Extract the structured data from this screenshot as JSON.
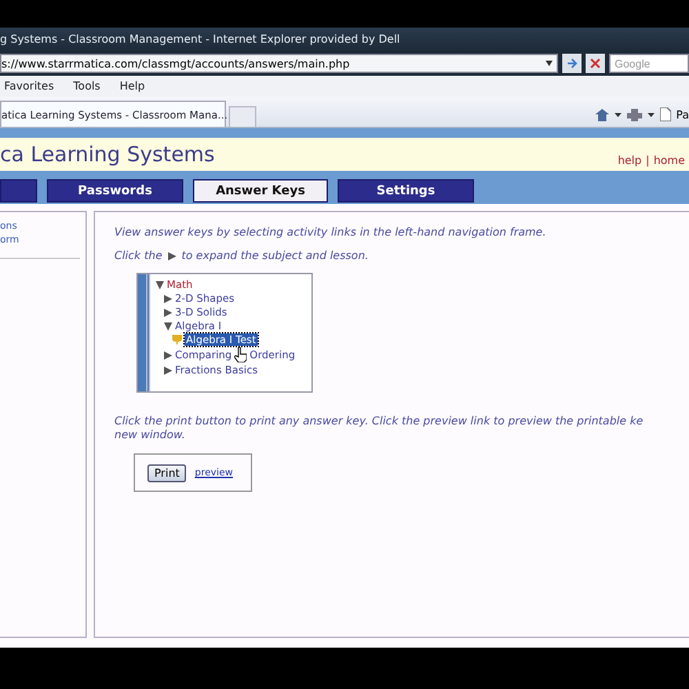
{
  "window": {
    "title": "g Systems - Classroom Management - Internet Explorer provided by Dell"
  },
  "address_bar": {
    "url": "s://www.starrmatica.com/classmgt/accounts/answers/main.php"
  },
  "search": {
    "placeholder": "Google"
  },
  "menu": [
    "Favorites",
    "Tools",
    "Help"
  ],
  "browser_tab": {
    "label": "atica Learning Systems - Classroom Mana..."
  },
  "toolbar": {
    "page_label": "Pa"
  },
  "site": {
    "title": "ca Learning Systems",
    "links": [
      "help",
      "home"
    ],
    "separator": "|"
  },
  "nav_tabs": [
    {
      "selected": false
    },
    {
      "label": "Passwords",
      "selected": false
    },
    {
      "label": "Answer Keys",
      "selected": true
    },
    {
      "label": "Settings",
      "selected": false
    }
  ],
  "sidebar": {
    "links": [
      "ons",
      "orm"
    ]
  },
  "content": {
    "intro": "View answer keys by selecting activity links in the left-hand navigation frame.",
    "expand_hint": {
      "before": "Click the",
      "after": "to expand the subject and lesson."
    },
    "tree": [
      {
        "label": "Math",
        "kind": "folder",
        "expanded": true,
        "children": [
          {
            "label": "2-D Shapes",
            "kind": "folder",
            "expanded": false
          },
          {
            "label": "3-D Solids",
            "kind": "folder",
            "expanded": false
          },
          {
            "label": "Algebra I",
            "kind": "folder",
            "expanded": true,
            "children": [
              {
                "label": "Algebra I Test",
                "kind": "test",
                "selected": true
              }
            ]
          },
          {
            "label": "Comparing",
            "label_after_cursor": "Ordering",
            "kind": "folder",
            "expanded": false
          },
          {
            "label": "Fractions Basics",
            "kind": "folder",
            "expanded": false
          }
        ]
      }
    ],
    "print_hint": "Click the print button to print any answer key. Click the preview link to preview the printable ke\nnew window.",
    "print_button": "Print",
    "preview_link": "preview"
  }
}
